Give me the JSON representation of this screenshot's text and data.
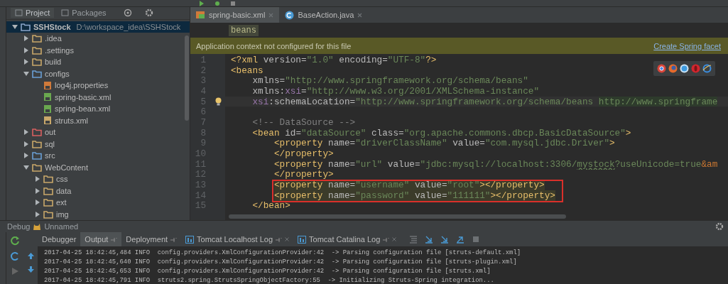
{
  "project": {
    "tabs": [
      {
        "label": "Project",
        "selected": true
      },
      {
        "label": "Packages",
        "selected": false
      }
    ],
    "tree": [
      {
        "label": "SSHStock",
        "path": "D:\\workspace_idea\\SSHStock",
        "kind": "module",
        "expanded": true,
        "selected": true,
        "children": [
          {
            "label": ".idea",
            "kind": "folder",
            "expanded": false,
            "selected": false
          },
          {
            "label": ".settings",
            "kind": "folder",
            "expanded": false,
            "selected": false
          },
          {
            "label": "build",
            "kind": "folder",
            "expanded": false,
            "selected": false
          },
          {
            "label": "configs",
            "kind": "source-folder",
            "expanded": true,
            "selected": false,
            "children": [
              {
                "label": "log4j.properties",
                "kind": "properties-file",
                "selected": false
              },
              {
                "label": "spring-basic.xml",
                "kind": "spring-file",
                "selected": false
              },
              {
                "label": "spring-bean.xml",
                "kind": "spring-file",
                "selected": false
              },
              {
                "label": "struts.xml",
                "kind": "struts-file",
                "selected": false
              }
            ]
          },
          {
            "label": "out",
            "kind": "excluded-folder",
            "expanded": false,
            "selected": false
          },
          {
            "label": "sql",
            "kind": "folder",
            "expanded": false,
            "selected": false
          },
          {
            "label": "src",
            "kind": "source-folder",
            "expanded": false,
            "selected": false
          },
          {
            "label": "WebContent",
            "kind": "web-folder",
            "expanded": true,
            "selected": false,
            "children": [
              {
                "label": "css",
                "kind": "folder",
                "expanded": false,
                "selected": false
              },
              {
                "label": "data",
                "kind": "folder",
                "expanded": false,
                "selected": false
              },
              {
                "label": "ext",
                "kind": "folder",
                "expanded": false,
                "selected": false
              },
              {
                "label": "img",
                "kind": "folder",
                "expanded": false,
                "selected": false
              }
            ]
          }
        ]
      }
    ]
  },
  "editor": {
    "tabs": [
      {
        "label": "spring-basic.xml",
        "kind": "xml",
        "selected": true
      },
      {
        "label": "BaseAction.java",
        "kind": "java",
        "selected": false
      }
    ],
    "breadcrumb": "beans",
    "notification": {
      "message": "Application context not configured for this file",
      "link": "Create Spring facet"
    },
    "lines": [
      {
        "number": "1",
        "current": false,
        "highlighted": false,
        "boxed": false,
        "tokens": [
          {
            "t": "<?xml",
            "kind": "tag"
          },
          {
            "t": " version=",
            "kind": "attr"
          },
          {
            "t": "\"1.0\"",
            "kind": "value"
          },
          {
            "t": " encoding=",
            "kind": "attr"
          },
          {
            "t": "\"UTF-8\"",
            "kind": "value"
          },
          {
            "t": "?>",
            "kind": "tag"
          }
        ]
      },
      {
        "number": "2",
        "current": false,
        "highlighted": false,
        "boxed": false,
        "tokens": [
          {
            "t": "<beans",
            "kind": "tag"
          }
        ]
      },
      {
        "number": "3",
        "current": false,
        "highlighted": false,
        "boxed": false,
        "tokens": [
          {
            "t": "    xmlns=",
            "kind": "attr"
          },
          {
            "t": "\"http://www.springframework.org/schema/beans\"",
            "kind": "value"
          }
        ]
      },
      {
        "number": "4",
        "current": false,
        "highlighted": false,
        "boxed": false,
        "tokens": [
          {
            "t": "    xmlns:",
            "kind": "attr"
          },
          {
            "t": "xsi",
            "kind": "ns"
          },
          {
            "t": "=",
            "kind": "attr"
          },
          {
            "t": "\"http://www.w3.org/2001/XMLSchema-instance\"",
            "kind": "value"
          }
        ]
      },
      {
        "number": "5",
        "current": true,
        "highlighted": false,
        "boxed": false,
        "tokens": [
          {
            "t": "    xsi",
            "kind": "ns"
          },
          {
            "t": ":schemaLocation=",
            "kind": "attr"
          },
          {
            "t": "\"http://www.springframework.org/schema/beans ",
            "kind": "value"
          },
          {
            "t": "http://www.springframe",
            "kind": "marked"
          }
        ]
      },
      {
        "number": "6",
        "current": false,
        "boxed": false
      },
      {
        "number": "7",
        "current": false,
        "highlighted": false,
        "boxed": false,
        "tokens": [
          {
            "t": "    <!-- DataSource -->",
            "kind": "comment"
          }
        ]
      },
      {
        "number": "8",
        "current": false,
        "highlighted": false,
        "boxed": false,
        "tokens": [
          {
            "t": "    <bean",
            "kind": "tag"
          },
          {
            "t": " id=",
            "kind": "attr"
          },
          {
            "t": "\"dataSource\"",
            "kind": "value"
          },
          {
            "t": " class=",
            "kind": "attr"
          },
          {
            "t": "\"org.apache.commons.dbcp.BasicDataSource\"",
            "kind": "value"
          },
          {
            "t": ">",
            "kind": "tag"
          }
        ]
      },
      {
        "number": "9",
        "current": false,
        "highlighted": false,
        "boxed": false,
        "tokens": [
          {
            "t": "        <property",
            "kind": "tag"
          },
          {
            "t": " name=",
            "kind": "attr"
          },
          {
            "t": "\"driverClassName\"",
            "kind": "value"
          },
          {
            "t": " value=",
            "kind": "attr"
          },
          {
            "t": "\"com.mysql.jdbc.Driver\"",
            "kind": "value"
          },
          {
            "t": ">",
            "kind": "tag"
          }
        ]
      },
      {
        "number": "10",
        "current": false,
        "highlighted": false,
        "boxed": false,
        "tokens": [
          {
            "t": "        </property>",
            "kind": "tag"
          }
        ]
      },
      {
        "number": "11",
        "current": false,
        "highlighted": false,
        "boxed": false,
        "tokens": [
          {
            "t": "        <property",
            "kind": "tag"
          },
          {
            "t": " name=",
            "kind": "attr"
          },
          {
            "t": "\"url\"",
            "kind": "value"
          },
          {
            "t": " value=",
            "kind": "attr"
          },
          {
            "t": "\"jdbc:mysql://localhost:3306/",
            "kind": "value"
          },
          {
            "t": "mystock",
            "kind": "typo"
          },
          {
            "t": "?useUnicode=true",
            "kind": "value"
          },
          {
            "t": "&am",
            "kind": "entity"
          }
        ]
      },
      {
        "number": "12",
        "current": false,
        "highlighted": false,
        "boxed": false,
        "tokens": [
          {
            "t": "        </property>",
            "kind": "tag"
          }
        ]
      },
      {
        "number": "13",
        "current": false,
        "highlighted": true,
        "boxed": true,
        "tokens": [
          {
            "t": "        <property",
            "kind": "tag"
          },
          {
            "t": " name=",
            "kind": "attr"
          },
          {
            "t": "\"username\"",
            "kind": "value"
          },
          {
            "t": " value=",
            "kind": "attr"
          },
          {
            "t": "\"root\"",
            "kind": "value"
          },
          {
            "t": "></property>",
            "kind": "tag"
          }
        ]
      },
      {
        "number": "14",
        "current": false,
        "highlighted": true,
        "boxed": true,
        "tokens": [
          {
            "t": "        <property",
            "kind": "tag"
          },
          {
            "t": " name=",
            "kind": "attr"
          },
          {
            "t": "\"password\"",
            "kind": "value"
          },
          {
            "t": " value=",
            "kind": "attr"
          },
          {
            "t": "\"111111\"",
            "kind": "value"
          },
          {
            "t": "></property>",
            "kind": "tag"
          }
        ]
      },
      {
        "number": "15",
        "current": false,
        "highlighted": false,
        "boxed": false,
        "tokens": [
          {
            "t": "    </bean>",
            "kind": "tag"
          }
        ]
      }
    ]
  },
  "debug": {
    "title": "Debug",
    "config": "Unnamed",
    "tabs": [
      {
        "label": "Debugger",
        "kind": "plain",
        "selected": false
      },
      {
        "label": "Output",
        "kind": "pinned",
        "selected": true
      },
      {
        "label": "Deployment",
        "kind": "pinned",
        "selected": false
      },
      {
        "label": "Tomcat Localhost Log",
        "kind": "log",
        "selected": false
      },
      {
        "label": "Tomcat Catalina Log",
        "kind": "log",
        "selected": false
      }
    ],
    "log": [
      "2017-04-25 18:42:45,484 INFO  config.providers.XmlConfigurationProvider:42  -> Parsing configuration file [struts-default.xml]",
      "2017-04-25 18:42:45,640 INFO  config.providers.XmlConfigurationProvider:42  -> Parsing configuration file [struts-plugin.xml]",
      "2017-04-25 18:42:45,653 INFO  config.providers.XmlConfigurationProvider:42  -> Parsing configuration file [struts.xml]",
      "2017-04-25 18:42:45,791 INFO  struts2.spring.StrutsSpringObjectFactory:55  -> Initializing Struts-Spring integration..."
    ]
  }
}
